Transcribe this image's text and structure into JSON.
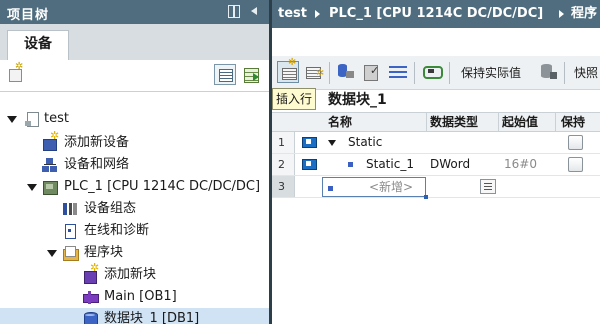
{
  "project_tree": {
    "title": "项目树",
    "tab_label": "设备",
    "items": [
      {
        "label": "test",
        "icon": "project-doc-icon"
      },
      {
        "label": "添加新设备",
        "icon": "add-device-icon"
      },
      {
        "label": "设备和网络",
        "icon": "network-icon"
      },
      {
        "label": "PLC_1 [CPU 1214C DC/DC/DC]",
        "icon": "plc-icon"
      },
      {
        "label": "设备组态",
        "icon": "device-config-icon"
      },
      {
        "label": "在线和诊断",
        "icon": "diagnostics-icon"
      },
      {
        "label": "程序块",
        "icon": "folder-icon"
      },
      {
        "label": "添加新块",
        "icon": "add-block-icon"
      },
      {
        "label": "Main [OB1]",
        "icon": "ob-icon"
      },
      {
        "label": "数据块_1 [DB1]",
        "icon": "db-icon"
      }
    ]
  },
  "editor": {
    "breadcrumb": [
      "test",
      "PLC_1 [CPU 1214C DC/DC/DC]",
      "程序"
    ],
    "toolbar": {
      "keep_actual_label": "保持实际值",
      "snapshot_label": "快照"
    },
    "tooltip": "插入行",
    "block_title": "数据块_1",
    "columns": [
      "名称",
      "数据类型",
      "起始值",
      "保持"
    ],
    "rows": [
      {
        "num": "1",
        "name": "Static",
        "type": "",
        "start": ""
      },
      {
        "num": "2",
        "name": "Static_1",
        "type": "DWord",
        "start": "16#0"
      },
      {
        "num": "3",
        "name": "<新增>",
        "type": "",
        "start": ""
      }
    ]
  },
  "colors": {
    "header_bg": "#4f6d7e",
    "selection_bg": "#d0e3f5",
    "interface_icon": "#1a6fc4"
  }
}
